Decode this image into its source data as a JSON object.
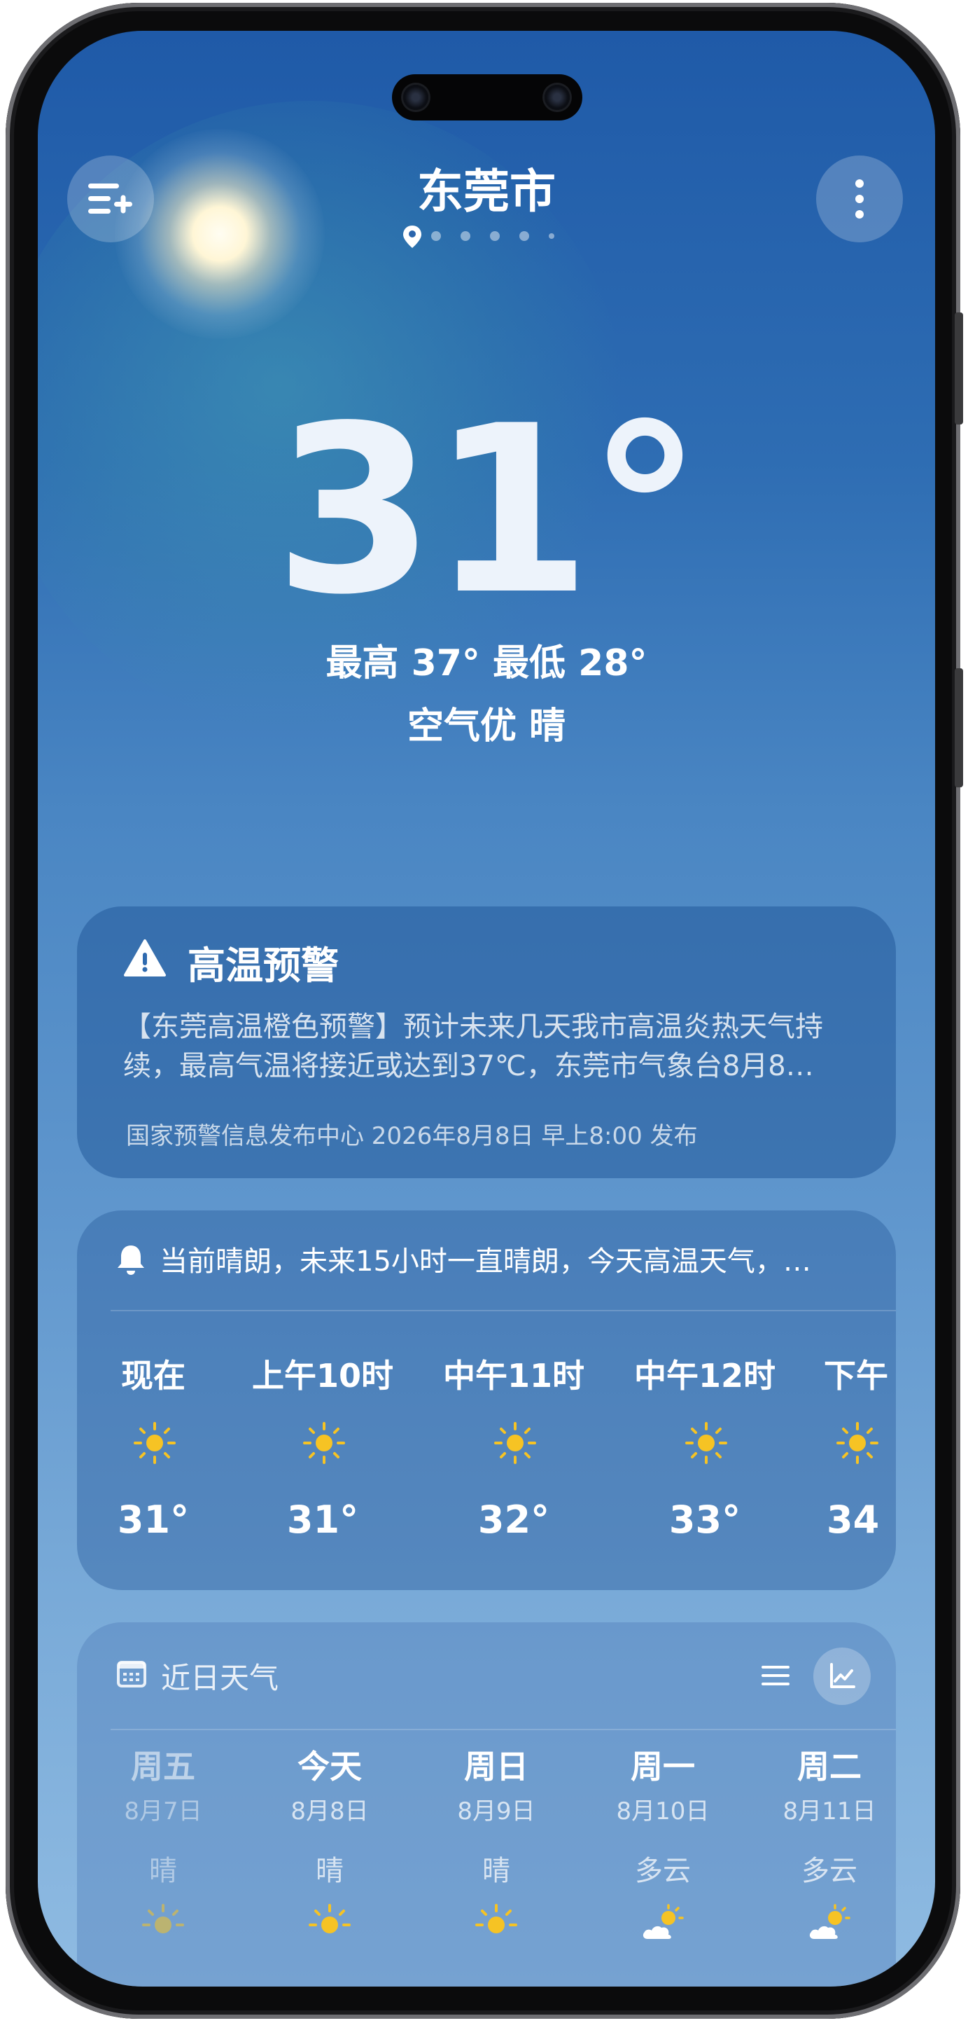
{
  "header": {
    "city": "东莞市"
  },
  "current": {
    "temperature": "31°",
    "high_low": "最高 37° 最低 28°",
    "condition": "空气优  晴"
  },
  "alert": {
    "title": "高温预警",
    "body_line1": "【东莞高温橙色预警】预计未来几天我市高温炎热天气持",
    "body_line2": "续，最高气温将接近或达到37℃，东莞市气象台8月8…",
    "source": "国家预警信息发布中心 2026年8月8日 早上8:00 发布"
  },
  "hourly": {
    "summary": "当前晴朗，未来15小时一直晴朗，今天高温天气，…",
    "items": [
      {
        "label": "现在",
        "temp": "31°",
        "icon": "sun-icon"
      },
      {
        "label": "上午10时",
        "temp": "31°",
        "icon": "sun-icon"
      },
      {
        "label": "中午11时",
        "temp": "32°",
        "icon": "sun-icon"
      },
      {
        "label": "中午12时",
        "temp": "33°",
        "icon": "sun-icon"
      },
      {
        "label": "下午",
        "temp": "34",
        "icon": "sun-icon"
      }
    ]
  },
  "daily": {
    "title": "近日天气",
    "items": [
      {
        "name": "周五",
        "date": "8月7日",
        "weather": "晴",
        "icon": "sun-icon"
      },
      {
        "name": "今天",
        "date": "8月8日",
        "weather": "晴",
        "icon": "sun-icon"
      },
      {
        "name": "周日",
        "date": "8月9日",
        "weather": "晴",
        "icon": "sun-icon"
      },
      {
        "name": "周一",
        "date": "8月10日",
        "weather": "多云",
        "icon": "partly-cloudy-icon"
      },
      {
        "name": "周二",
        "date": "8月11日",
        "weather": "多云",
        "icon": "partly-cloudy-icon"
      }
    ]
  },
  "colors": {
    "sun": "#f6c324",
    "sky_top": "#1f5aa8",
    "sky_bottom": "#8fbbe2"
  }
}
